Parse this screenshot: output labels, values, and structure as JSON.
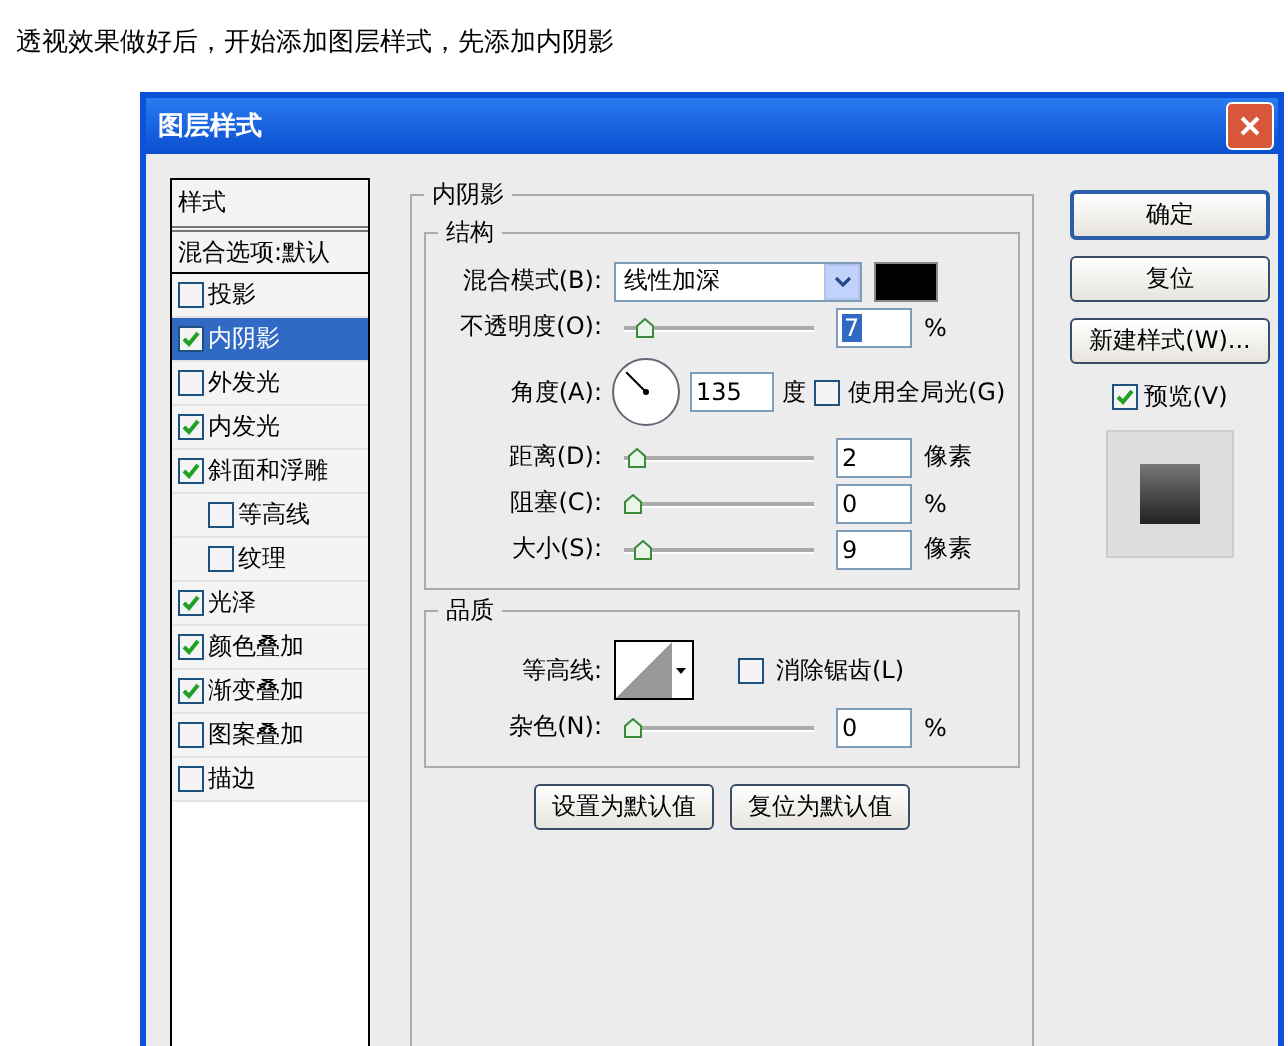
{
  "caption": "透视效果做好后，开始添加图层样式，先添加内阴影",
  "window": {
    "title": "图层样式"
  },
  "styles_list": {
    "header": "样式",
    "blend_options": "混合选项:默认",
    "items": [
      {
        "label": "投影",
        "checked": false,
        "selected": false
      },
      {
        "label": "内阴影",
        "checked": true,
        "selected": true
      },
      {
        "label": "外发光",
        "checked": false,
        "selected": false
      },
      {
        "label": "内发光",
        "checked": true,
        "selected": false
      },
      {
        "label": "斜面和浮雕",
        "checked": true,
        "selected": false,
        "children": [
          {
            "label": "等高线",
            "checked": false,
            "selected": false
          },
          {
            "label": "纹理",
            "checked": false,
            "selected": false
          }
        ]
      },
      {
        "label": "光泽",
        "checked": true,
        "selected": false
      },
      {
        "label": "颜色叠加",
        "checked": true,
        "selected": false
      },
      {
        "label": "渐变叠加",
        "checked": true,
        "selected": false
      },
      {
        "label": "图案叠加",
        "checked": false,
        "selected": false
      },
      {
        "label": "描边",
        "checked": false,
        "selected": false
      }
    ]
  },
  "panel": {
    "title": "内阴影",
    "structure": {
      "title": "结构",
      "blend_mode": {
        "label": "混合模式(B):",
        "value": "线性加深",
        "color": "#000000"
      },
      "opacity": {
        "label": "不透明度(O):",
        "level": 0.07,
        "value": "7",
        "unit": "%",
        "highlighted": true
      },
      "angle": {
        "label": "角度(A):",
        "value": "135",
        "unit": "度",
        "global_light": {
          "label": "使用全局光(G)",
          "checked": false
        }
      },
      "sliders": [
        {
          "label": "距离(D):",
          "level": 0.02,
          "value": "2",
          "unit": "像素",
          "highlighted": false
        },
        {
          "label": "阻塞(C):",
          "level": 0,
          "value": "0",
          "unit": "%",
          "highlighted": false
        },
        {
          "label": "大小(S):",
          "level": 0.06,
          "value": "9",
          "unit": "像素",
          "highlighted": false
        }
      ]
    },
    "quality": {
      "title": "品质",
      "contour": {
        "label": "等高线:"
      },
      "anti_alias": {
        "label": "消除锯齿(L)",
        "checked": false
      },
      "noise": {
        "label": "杂色(N):",
        "level": 0,
        "value": "0",
        "unit": "%",
        "highlighted": false
      }
    },
    "buttons": [
      "设置为默认值",
      "复位为默认值"
    ]
  },
  "actions": [
    {
      "label": "确定",
      "default": true
    },
    {
      "label": "复位",
      "default": false
    },
    {
      "label": "新建样式(W)...",
      "default": false
    }
  ],
  "preview": {
    "label": "预览(V)",
    "checked": true
  }
}
